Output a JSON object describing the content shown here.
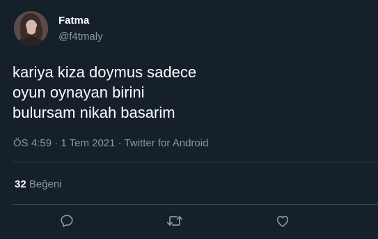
{
  "user": {
    "display_name": "Fatma",
    "handle": "@f4tmaly"
  },
  "tweet": {
    "lines": [
      "kariya kiza doymus sadece",
      "oyun oynayan birini",
      "bulursam nikah basarim"
    ],
    "meta": "ÖS 4:59 · 1 Tem 2021 · Twitter for Android"
  },
  "stats": {
    "likes_count": "32",
    "likes_label": "Beğeni"
  },
  "actions": {
    "icons": [
      "reply-icon",
      "retweet-icon",
      "like-icon"
    ]
  },
  "colors": {
    "background": "#15202b",
    "text_primary": "#ffffff",
    "text_secondary": "#8899a6",
    "divider": "#38444d"
  }
}
